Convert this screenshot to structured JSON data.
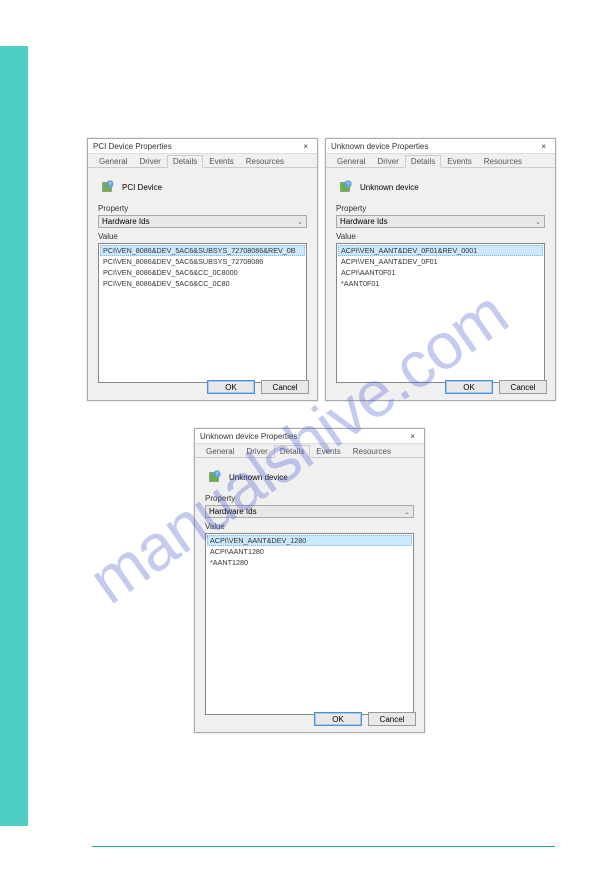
{
  "watermark": "manualshive.com",
  "dialogs": {
    "d1": {
      "title": "PCI Device Properties",
      "tabs": [
        "General",
        "Driver",
        "Details",
        "Events",
        "Resources"
      ],
      "deviceName": "PCI Device",
      "propLabel": "Property",
      "propValue": "Hardware Ids",
      "valueLabel": "Value",
      "items": [
        "PCI\\VEN_8086&DEV_5AC6&SUBSYS_72708086&REV_0B",
        "PCI\\VEN_8086&DEV_5AC6&SUBSYS_72708086",
        "PCI\\VEN_8086&DEV_5AC6&CC_0C8000",
        "PCI\\VEN_8086&DEV_5AC6&CC_0C80"
      ],
      "ok": "OK",
      "cancel": "Cancel"
    },
    "d2": {
      "title": "Unknown device Properties",
      "tabs": [
        "General",
        "Driver",
        "Details",
        "Events",
        "Resources"
      ],
      "deviceName": "Unknown device",
      "propLabel": "Property",
      "propValue": "Hardware Ids",
      "valueLabel": "Value",
      "items": [
        "ACPI\\VEN_AANT&DEV_0F01&REV_0001",
        "ACPI\\VEN_AANT&DEV_0F01",
        "ACPI\\AANT0F01",
        "*AANT0F01"
      ],
      "ok": "OK",
      "cancel": "Cancel"
    },
    "d3": {
      "title": "Unknown device Properties",
      "tabs": [
        "General",
        "Driver",
        "Details",
        "Events",
        "Resources"
      ],
      "deviceName": "Unknown device",
      "propLabel": "Property",
      "propValue": "Hardware Ids",
      "valueLabel": "Value",
      "items": [
        "ACPI\\VEN_AANT&DEV_1280",
        "ACPI\\AANT1280",
        "*AANT1280"
      ],
      "ok": "OK",
      "cancel": "Cancel"
    }
  }
}
